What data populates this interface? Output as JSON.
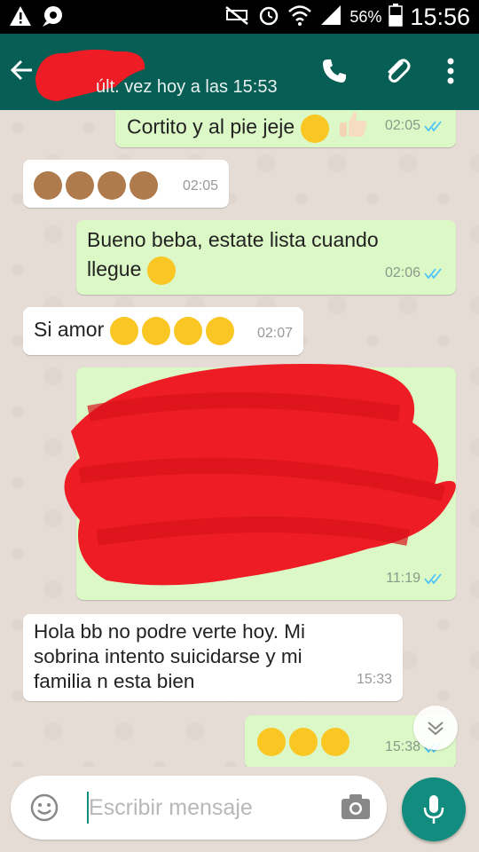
{
  "status_bar": {
    "time": "15:56",
    "battery_percent": "56%",
    "icons": [
      "warning-icon",
      "notification-icon",
      "mute-icon",
      "alarm-icon",
      "wifi-icon",
      "signal-icon",
      "battery-icon"
    ]
  },
  "header": {
    "contact_name": "",
    "last_seen": "últ. vez hoy a las 15:53",
    "icons": [
      "back-arrow-icon",
      "phone-icon",
      "attach-icon",
      "more-vert-icon"
    ],
    "color": "#075e54"
  },
  "messages": [
    {
      "direction": "out",
      "text": "Cortito y al pie jeje",
      "emojis": [
        "smile",
        "thumbs-up"
      ],
      "time": "02:05",
      "read": true
    },
    {
      "direction": "in",
      "text": "",
      "emojis": [
        "see-no-evil-monkey",
        "see-no-evil-monkey",
        "see-no-evil-monkey",
        "see-no-evil-monkey"
      ],
      "time": "02:05"
    },
    {
      "direction": "out",
      "text": "Bueno beba, estate lista cuando llegue",
      "emojis": [
        "kissing-smiling-eyes"
      ],
      "time": "02:06",
      "read": true
    },
    {
      "direction": "in",
      "text": "Si amor",
      "emojis": [
        "heart-eyes",
        "heart-eyes",
        "heart-eyes",
        "kissing-heart"
      ],
      "time": "02:07"
    },
    {
      "direction": "out",
      "text": "",
      "redacted": true,
      "time": "11:19",
      "read": true
    },
    {
      "direction": "in",
      "text": "Hola bb no podre verte hoy.  Mi sobrina intento suicidarse y mi familia n esta bien",
      "time": "15:33"
    },
    {
      "direction": "out",
      "text": "",
      "emojis": [
        "confused",
        "worried",
        "frowning"
      ],
      "time": "15:38",
      "read": true
    }
  ],
  "input": {
    "placeholder": "Escribir mensaje",
    "value": ""
  },
  "colors": {
    "outgoing_bubble": "#dcf8c6",
    "incoming_bubble": "#ffffff",
    "accent": "#128c7e",
    "read_ticks": "#4fc3f7",
    "redaction": "#ee1c24"
  }
}
